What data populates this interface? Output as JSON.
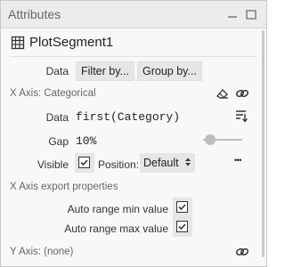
{
  "panel": {
    "title": "Attributes",
    "header_icon": "table-icon",
    "object_name": "PlotSegment1"
  },
  "data_row": {
    "label": "Data",
    "filter_label": "Filter by...",
    "group_label": "Group by..."
  },
  "x_axis": {
    "heading": "X Axis: Categorical",
    "data_label": "Data",
    "data_value": "first(Category)",
    "gap_label": "Gap",
    "gap_value": "10%",
    "gap_slider_fraction": 0.05,
    "visible_label": "Visible",
    "visible_checked": true,
    "position_label": "Position:",
    "position_value": "Default",
    "more_label": "•••"
  },
  "x_axis_export": {
    "heading": "X Axis export properties",
    "auto_min_label": "Auto range min value",
    "auto_min_checked": true,
    "auto_max_label": "Auto range max value",
    "auto_max_checked": true
  },
  "y_axis": {
    "heading": "Y Axis: (none)"
  }
}
